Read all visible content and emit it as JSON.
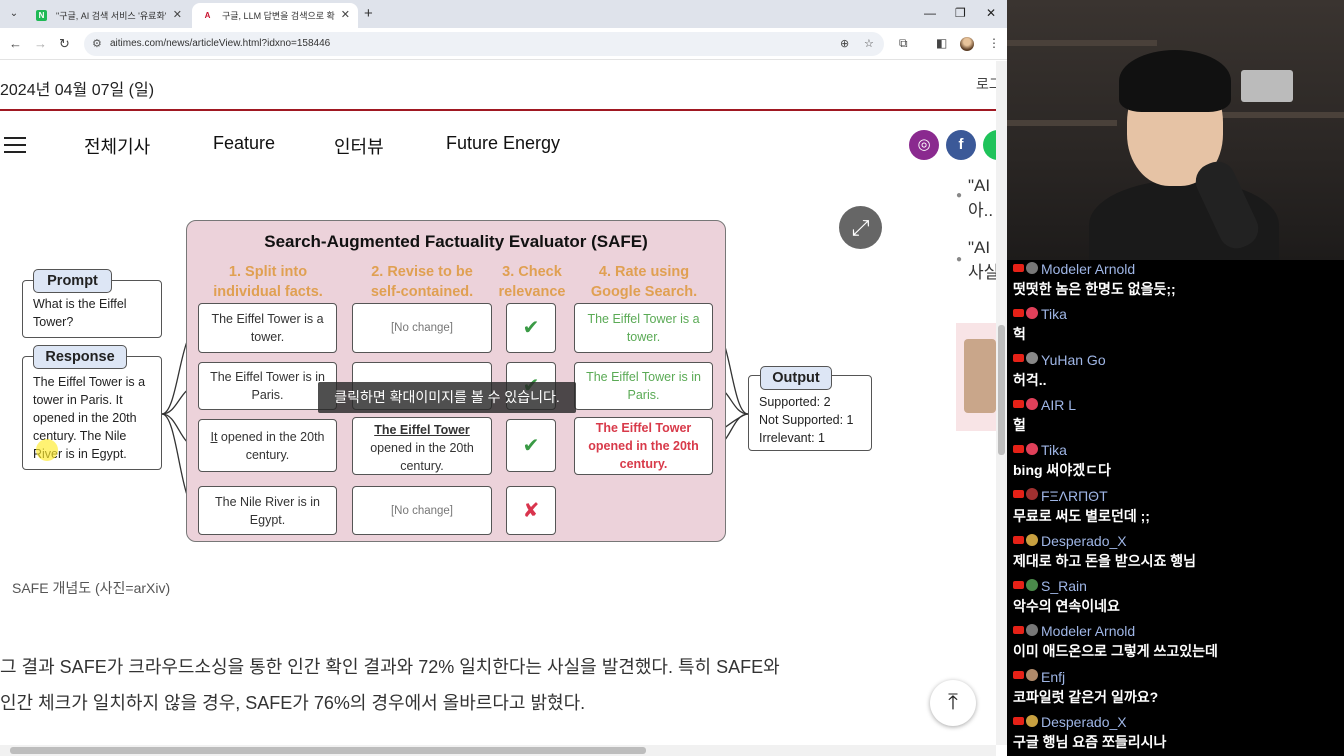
{
  "browser": {
    "tabs": [
      {
        "title": "\"구글, AI 검색 서비스 '유료화'",
        "favicon": "N",
        "favicon_color": "#1fb955"
      },
      {
        "title": "구글, LLM 답변을 검색으로 확",
        "favicon": "A",
        "favicon_color": "#c8102e"
      }
    ],
    "url": "aitimes.com/news/articleView.html?idxno=158446"
  },
  "page": {
    "date": "2024년 04월 07일 (일)",
    "login": "로그",
    "nav": [
      "전체기사",
      "Feature",
      "인터뷰",
      "Future Energy"
    ],
    "social": [
      {
        "name": "instagram",
        "glyph": "◎",
        "color": "#8a2a8f"
      },
      {
        "name": "facebook",
        "glyph": "f",
        "color": "#3b5998"
      },
      {
        "name": "other",
        "glyph": "",
        "color": "#1fc35a"
      }
    ],
    "side_items": [
      [
        "\"AI",
        "아.."
      ],
      [
        "\"AI",
        "사실"
      ]
    ],
    "caption": "SAFE 개념도 (사진=arXiv)",
    "paragraph": [
      "그 결과 SAFE가 크라우드소싱을 통한 인간 확인 결과와 72% 일치한다는 사실을 발견했다. 특히 SAFE와",
      "인간 체크가 일치하지 않을 경우, SAFE가 76%의 경우에서 올바르다고 밝혔다."
    ],
    "tooltip": "클릭하면 확대이미지를 볼 수 있습니다."
  },
  "figure": {
    "title": "Search-Augmented Factuality Evaluator (SAFE)",
    "steps": [
      [
        "1. Split into",
        "individual facts."
      ],
      [
        "2. Revise to be",
        "self-contained."
      ],
      [
        "3. Check",
        "relevance"
      ],
      [
        "4. Rate using",
        "Google Search."
      ]
    ],
    "prompt_label": "Prompt",
    "prompt_text": "What is the Eiffel Tower?",
    "response_label": "Response",
    "response_text": "The Eiffel Tower is a tower in Paris. It opened in the 20th century. The Nile River is in Egypt.",
    "output_label": "Output",
    "output_lines": [
      "Supported: 2",
      "Not Supported: 1",
      "Irrelevant: 1"
    ],
    "rows": [
      {
        "fact": "The Eiffel Tower is a tower.",
        "revised": "[No change]",
        "relevant": "✔",
        "rating": "The Eiffel Tower is a tower."
      },
      {
        "fact": "The Eiffel Tower is in Paris.",
        "revised": "",
        "relevant": "✔",
        "rating": "The Eiffel Tower is in Paris."
      },
      {
        "fact_underlined": "It",
        "fact_rest": " opened in the 20th century.",
        "revised_underlined": "The Eiffel Tower",
        "revised_rest": "opened in the 20th century.",
        "relevant": "✔",
        "rating": "The Eiffel Tower opened in the 20th century."
      },
      {
        "fact": "The Nile River is in Egypt.",
        "revised": "[No change]",
        "relevant": "✘"
      }
    ],
    "colors": {
      "supported": "#5aaa55",
      "not_supported": "#d83a4a",
      "check": "#3a9a45",
      "step_heading": "#e0a052",
      "panel": "#ecd2da"
    }
  },
  "chat": [
    {
      "user": "Modeler Arnold",
      "text": "떳떳한 놈은 한명도 없을듯;;",
      "avatar_color": "#777"
    },
    {
      "user": "Tika",
      "text": "헉",
      "avatar_color": "#e0405a"
    },
    {
      "user": "YuHan Go",
      "text": "허걱..",
      "avatar_color": "#888"
    },
    {
      "user": "AIR L",
      "text": "헐",
      "avatar_color": "#e0405a"
    },
    {
      "user": "Tika",
      "text": "bing 써야겠ㄷ다",
      "avatar_color": "#e0405a"
    },
    {
      "user": "FΞΛRПΘT",
      "text": "무료로 써도 별로던데 ;;",
      "avatar_color": "#a03030"
    },
    {
      "user": "Desperado_X",
      "text": "제대로 하고 돈을 받으시죠 행님",
      "avatar_color": "#c8a040"
    },
    {
      "user": "S_Rain",
      "text": "악수의 연속이네요",
      "avatar_color": "#4a8a4a"
    },
    {
      "user": "Modeler Arnold",
      "text": "이미 애드온으로 그렇게 쓰고있는데",
      "avatar_color": "#777"
    },
    {
      "user": "Enfj",
      "text": "코파일럿 같은거 일까요?",
      "avatar_color": "#b08a6a"
    },
    {
      "user": "Desperado_X",
      "text": "구글 행님 요즘 쪼들리시나",
      "avatar_color": "#c8a040"
    }
  ]
}
